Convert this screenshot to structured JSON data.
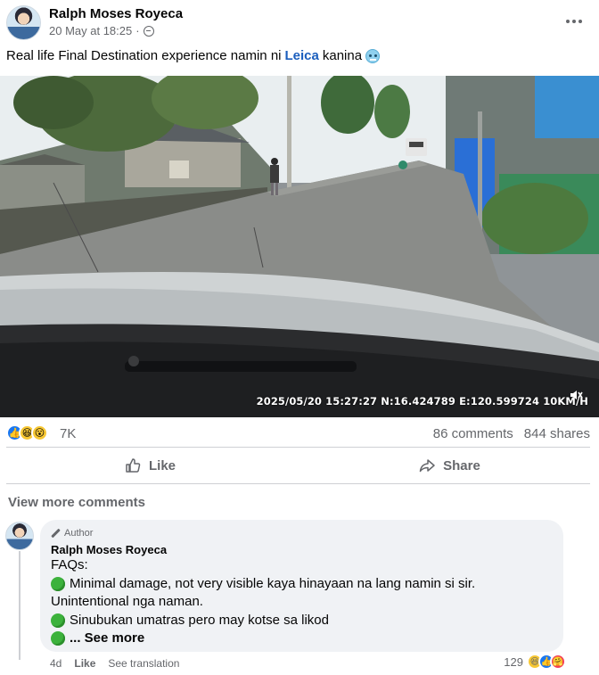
{
  "post": {
    "author": "Ralph Moses Royeca",
    "date": "20 May at 18:25",
    "date_sep": "·",
    "caption_before": "Real life Final Destination experience namin ni",
    "caption_mention": "Leica",
    "caption_after": "kanina",
    "caption_emoji": "cold-face-icon"
  },
  "video": {
    "timestamp": "2025/05/20 15:27:27 N:16.424789 E:120.599724 10KM/H"
  },
  "stats": {
    "reaction_icons": [
      "like",
      "haha",
      "wow"
    ],
    "reaction_count": "7K",
    "comments": "86 comments",
    "shares": "844 shares"
  },
  "actions": {
    "like": "Like",
    "share": "Share"
  },
  "comments_section": {
    "view_more": "View more comments",
    "comment": {
      "badge": "Author",
      "name": "Ralph Moses Royeca",
      "lines": [
        "FAQs:",
        "Minimal damage, not very visible kaya hinayaan na lang namin si sir.",
        "Unintentional nga naman.",
        "Sinubukan umatras pero may kotse sa likod",
        "... See more"
      ],
      "age": "4d",
      "like": "Like",
      "translate": "See translation",
      "reaction_count": "129",
      "reaction_icons": [
        "haha",
        "like",
        "love"
      ]
    }
  },
  "colors": {
    "accent": "#1877f2",
    "mention": "#1b5ebd",
    "secondary_text": "#65676b",
    "bubble": "#f0f2f5"
  }
}
